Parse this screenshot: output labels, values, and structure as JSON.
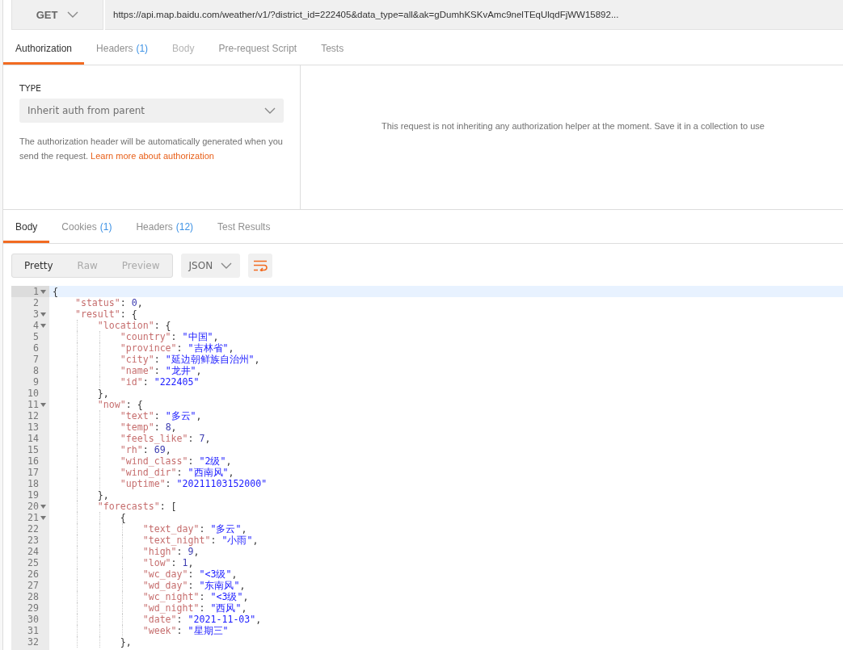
{
  "request": {
    "method": "GET",
    "url": "https://api.map.baidu.com/weather/v1/?district_id=222405&data_type=all&ak=gDumhKSKvAmc9nelTEqUlqdFjWW15892..."
  },
  "request_tabs": [
    {
      "label": "Authorization",
      "selected": true,
      "disabled": false
    },
    {
      "label": "Headers",
      "count": "(1)",
      "selected": false,
      "disabled": false
    },
    {
      "label": "Body",
      "selected": false,
      "disabled": true
    },
    {
      "label": "Pre-request Script",
      "selected": false,
      "disabled": false
    },
    {
      "label": "Tests",
      "selected": false,
      "disabled": false
    }
  ],
  "auth": {
    "type_label": "TYPE",
    "type_value": "Inherit auth from parent",
    "help_text": "The authorization header will be automatically generated when you send the request.",
    "help_link": "Learn more about authorization",
    "message": "This request is not inheriting any authorization helper at the moment. Save it in a collection to use"
  },
  "response_tabs": [
    {
      "label": "Body",
      "selected": true
    },
    {
      "label": "Cookies",
      "count": "(1)",
      "selected": false
    },
    {
      "label": "Headers",
      "count": "(12)",
      "selected": false
    },
    {
      "label": "Test Results",
      "selected": false
    }
  ],
  "view_modes": [
    {
      "label": "Pretty",
      "selected": true
    },
    {
      "label": "Raw",
      "selected": false
    },
    {
      "label": "Preview",
      "selected": false
    }
  ],
  "format": "JSON",
  "code": [
    {
      "no": "1",
      "fold": true,
      "active": true,
      "text": "{"
    },
    {
      "no": "2",
      "fold": false,
      "active": false,
      "text": "    \"status\": 0,"
    },
    {
      "no": "3",
      "fold": true,
      "active": false,
      "text": "    \"result\": {"
    },
    {
      "no": "4",
      "fold": true,
      "active": false,
      "text": "        \"location\": {"
    },
    {
      "no": "5",
      "fold": false,
      "active": false,
      "text": "            \"country\": \"中国\","
    },
    {
      "no": "6",
      "fold": false,
      "active": false,
      "text": "            \"province\": \"吉林省\","
    },
    {
      "no": "7",
      "fold": false,
      "active": false,
      "text": "            \"city\": \"延边朝鲜族自治州\","
    },
    {
      "no": "8",
      "fold": false,
      "active": false,
      "text": "            \"name\": \"龙井\","
    },
    {
      "no": "9",
      "fold": false,
      "active": false,
      "text": "            \"id\": \"222405\""
    },
    {
      "no": "10",
      "fold": false,
      "active": false,
      "text": "        },"
    },
    {
      "no": "11",
      "fold": true,
      "active": false,
      "text": "        \"now\": {"
    },
    {
      "no": "12",
      "fold": false,
      "active": false,
      "text": "            \"text\": \"多云\","
    },
    {
      "no": "13",
      "fold": false,
      "active": false,
      "text": "            \"temp\": 8,"
    },
    {
      "no": "14",
      "fold": false,
      "active": false,
      "text": "            \"feels_like\": 7,"
    },
    {
      "no": "15",
      "fold": false,
      "active": false,
      "text": "            \"rh\": 69,"
    },
    {
      "no": "16",
      "fold": false,
      "active": false,
      "text": "            \"wind_class\": \"2级\","
    },
    {
      "no": "17",
      "fold": false,
      "active": false,
      "text": "            \"wind_dir\": \"西南风\","
    },
    {
      "no": "18",
      "fold": false,
      "active": false,
      "text": "            \"uptime\": \"20211103152000\""
    },
    {
      "no": "19",
      "fold": false,
      "active": false,
      "text": "        },"
    },
    {
      "no": "20",
      "fold": true,
      "active": false,
      "text": "        \"forecasts\": ["
    },
    {
      "no": "21",
      "fold": true,
      "active": false,
      "text": "            {"
    },
    {
      "no": "22",
      "fold": false,
      "active": false,
      "text": "                \"text_day\": \"多云\","
    },
    {
      "no": "23",
      "fold": false,
      "active": false,
      "text": "                \"text_night\": \"小雨\","
    },
    {
      "no": "24",
      "fold": false,
      "active": false,
      "text": "                \"high\": 9,"
    },
    {
      "no": "25",
      "fold": false,
      "active": false,
      "text": "                \"low\": 1,"
    },
    {
      "no": "26",
      "fold": false,
      "active": false,
      "text": "                \"wc_day\": \"<3级\","
    },
    {
      "no": "27",
      "fold": false,
      "active": false,
      "text": "                \"wd_day\": \"东南风\","
    },
    {
      "no": "28",
      "fold": false,
      "active": false,
      "text": "                \"wc_night\": \"<3级\","
    },
    {
      "no": "29",
      "fold": false,
      "active": false,
      "text": "                \"wd_night\": \"西风\","
    },
    {
      "no": "30",
      "fold": false,
      "active": false,
      "text": "                \"date\": \"2021-11-03\","
    },
    {
      "no": "31",
      "fold": false,
      "active": false,
      "text": "                \"week\": \"星期三\""
    },
    {
      "no": "32",
      "fold": false,
      "active": false,
      "text": "            },"
    }
  ]
}
